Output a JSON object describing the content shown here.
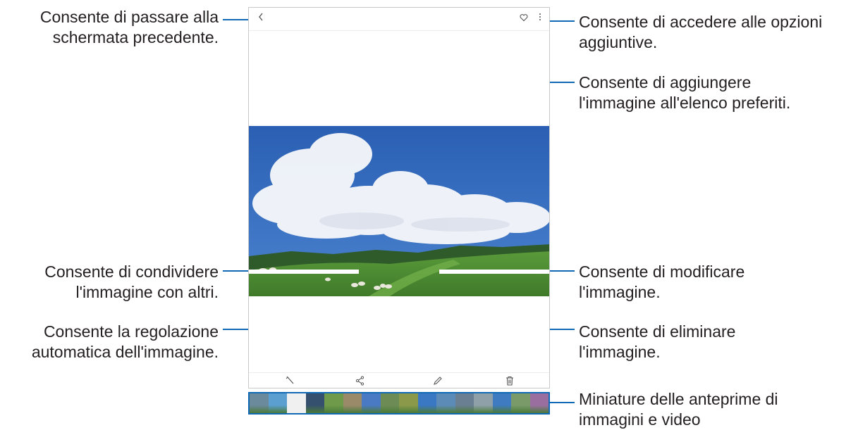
{
  "callouts": {
    "back": [
      "Consente di passare alla",
      "schermata precedente."
    ],
    "more_options": [
      "Consente di accedere alle opzioni",
      "aggiuntive."
    ],
    "favorite": [
      "Consente di aggiungere",
      "l'immagine all'elenco preferiti."
    ],
    "share": [
      "Consente di condividere",
      "l'immagine con altri."
    ],
    "edit": [
      "Consente di modificare",
      "l'immagine."
    ],
    "auto_adjust": [
      "Consente la regolazione",
      "automatica dell'immagine."
    ],
    "delete": [
      "Consente di eliminare",
      "l'immagine."
    ],
    "thumbnails": [
      "Miniature delle anteprime di",
      "immagini e video"
    ]
  },
  "icons": {
    "back": "chevron-left-icon",
    "favorite": "heart-icon",
    "more": "more-vertical-icon",
    "auto_adjust": "magic-wand-icon",
    "share": "share-icon",
    "edit": "pencil-icon",
    "delete": "trash-icon"
  },
  "colors": {
    "leader": "#0f69b4",
    "sky": "#2f63b8",
    "grass": "#4f8a34"
  },
  "thumbnails": [
    "#6b8a9c",
    "#5a9fd0",
    "#f0f0f0",
    "#35506e",
    "#6e9a4a",
    "#9a8a6a",
    "#4a7ac4",
    "#6d8c55",
    "#8a9a4a",
    "#3a78c4",
    "#5d8bb8",
    "#6a7f92",
    "#8fa0a8",
    "#3f7bc0",
    "#7a9a6a",
    "#9a6fa0"
  ]
}
